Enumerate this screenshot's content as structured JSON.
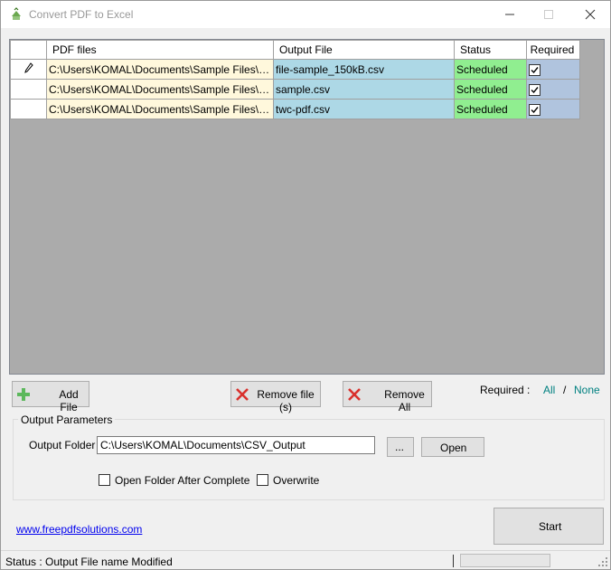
{
  "window": {
    "title": "Convert PDF to Excel"
  },
  "grid": {
    "columns": [
      "PDF files",
      "Output File",
      "Status",
      "Required"
    ],
    "rows": [
      {
        "pdf": "C:\\Users\\KOMAL\\Documents\\Sample Files\\file-s...",
        "output": "file-sample_150kB.csv",
        "status": "Scheduled",
        "required": true,
        "row_icon": "pencil-icon"
      },
      {
        "pdf": "C:\\Users\\KOMAL\\Documents\\Sample Files\\sam...",
        "output": "sample.csv",
        "status": "Scheduled",
        "required": true,
        "row_icon": ""
      },
      {
        "pdf": "C:\\Users\\KOMAL\\Documents\\Sample Files\\twc-...",
        "output": "twc-pdf.csv",
        "status": "Scheduled",
        "required": true,
        "row_icon": ""
      }
    ],
    "colors": {
      "pdf": "#fff8dc",
      "output": "#add8e6",
      "status": "#90ee90",
      "required": "#b0c4de",
      "background": "#ababab"
    }
  },
  "buttons": {
    "add_file": "Add File",
    "remove_file": "Remove file (s)",
    "remove_all": "Remove All",
    "browse": "...",
    "open": "Open",
    "start": "Start"
  },
  "required": {
    "label": "Required :",
    "all": "All",
    "separator": "/",
    "none": "None"
  },
  "output_params": {
    "title": "Output Parameters",
    "folder_label": "Output Folder",
    "folder_value": "C:\\Users\\KOMAL\\Documents\\CSV_Output",
    "open_after_label": "Open Folder After Complete",
    "open_after_checked": false,
    "overwrite_label": "Overwrite",
    "overwrite_checked": false
  },
  "link": "www.freepdfsolutions.com",
  "status": {
    "text": "Status :  Output File name Modified"
  }
}
